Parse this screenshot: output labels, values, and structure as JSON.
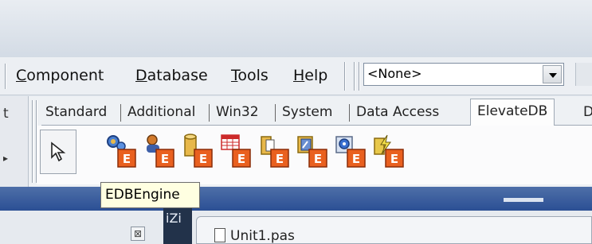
{
  "menu": {
    "items": [
      {
        "label": "Component",
        "underline": "C",
        "rest": "omponent"
      },
      {
        "label": "Database",
        "underline": "D",
        "rest": "atabase"
      },
      {
        "label": "Tools",
        "underline": "T",
        "rest": "ools"
      },
      {
        "label": "Help",
        "underline": "H",
        "rest": "elp"
      }
    ]
  },
  "combo": {
    "value": "<None>"
  },
  "left_panel": {
    "fragment": "t"
  },
  "palette": {
    "tabs": [
      "Standard",
      "Additional",
      "Win32",
      "System",
      "Data Access",
      "ElevateDB",
      "D"
    ],
    "active_tab": "ElevateDB"
  },
  "components": [
    {
      "name": "EDBEngine",
      "icon": "engine-gear-icon",
      "color": "#4a7fd0"
    },
    {
      "name": "",
      "icon": "session-user-icon",
      "color": "#d27a2c"
    },
    {
      "name": "",
      "icon": "database-cylinder-icon",
      "color": "#e8b84a"
    },
    {
      "name": "",
      "icon": "table-grid-icon",
      "color": "#cc2a2a"
    },
    {
      "name": "",
      "icon": "query-cylinder-icon",
      "color": "#e8b84a"
    },
    {
      "name": "",
      "icon": "stored-proc-icon",
      "color": "#6a8fd0"
    },
    {
      "name": "",
      "icon": "script-gear-icon",
      "color": "#3a6fd0"
    },
    {
      "name": "",
      "icon": "update-lightning-icon",
      "color": "#e8c84a"
    }
  ],
  "tooltip": {
    "text": "EDBEngine"
  },
  "bottom": {
    "dark_tab_text": "iZi",
    "close_glyph": "⊠",
    "form_caption": "Unit1.pas"
  },
  "colors": {
    "accent_blue": "#2b4f94",
    "badge_orange": "#e9601f",
    "tooltip_bg": "#ffffe1"
  }
}
